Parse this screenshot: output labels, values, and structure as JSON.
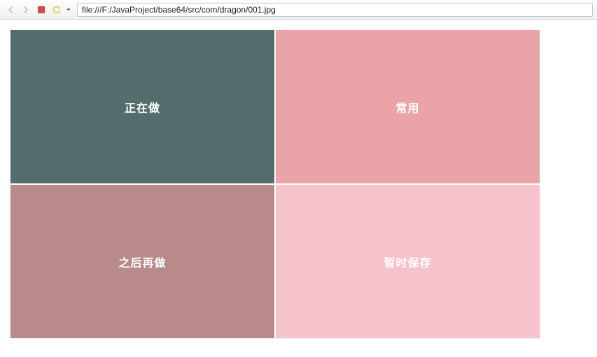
{
  "toolbar": {
    "address": "file:///F:/JavaProject/base64/src/com/dragon/001.jpg"
  },
  "tiles": {
    "top_left": "正在做",
    "top_right": "常用",
    "bottom_left": "之后再做",
    "bottom_right": "暂时保存"
  }
}
